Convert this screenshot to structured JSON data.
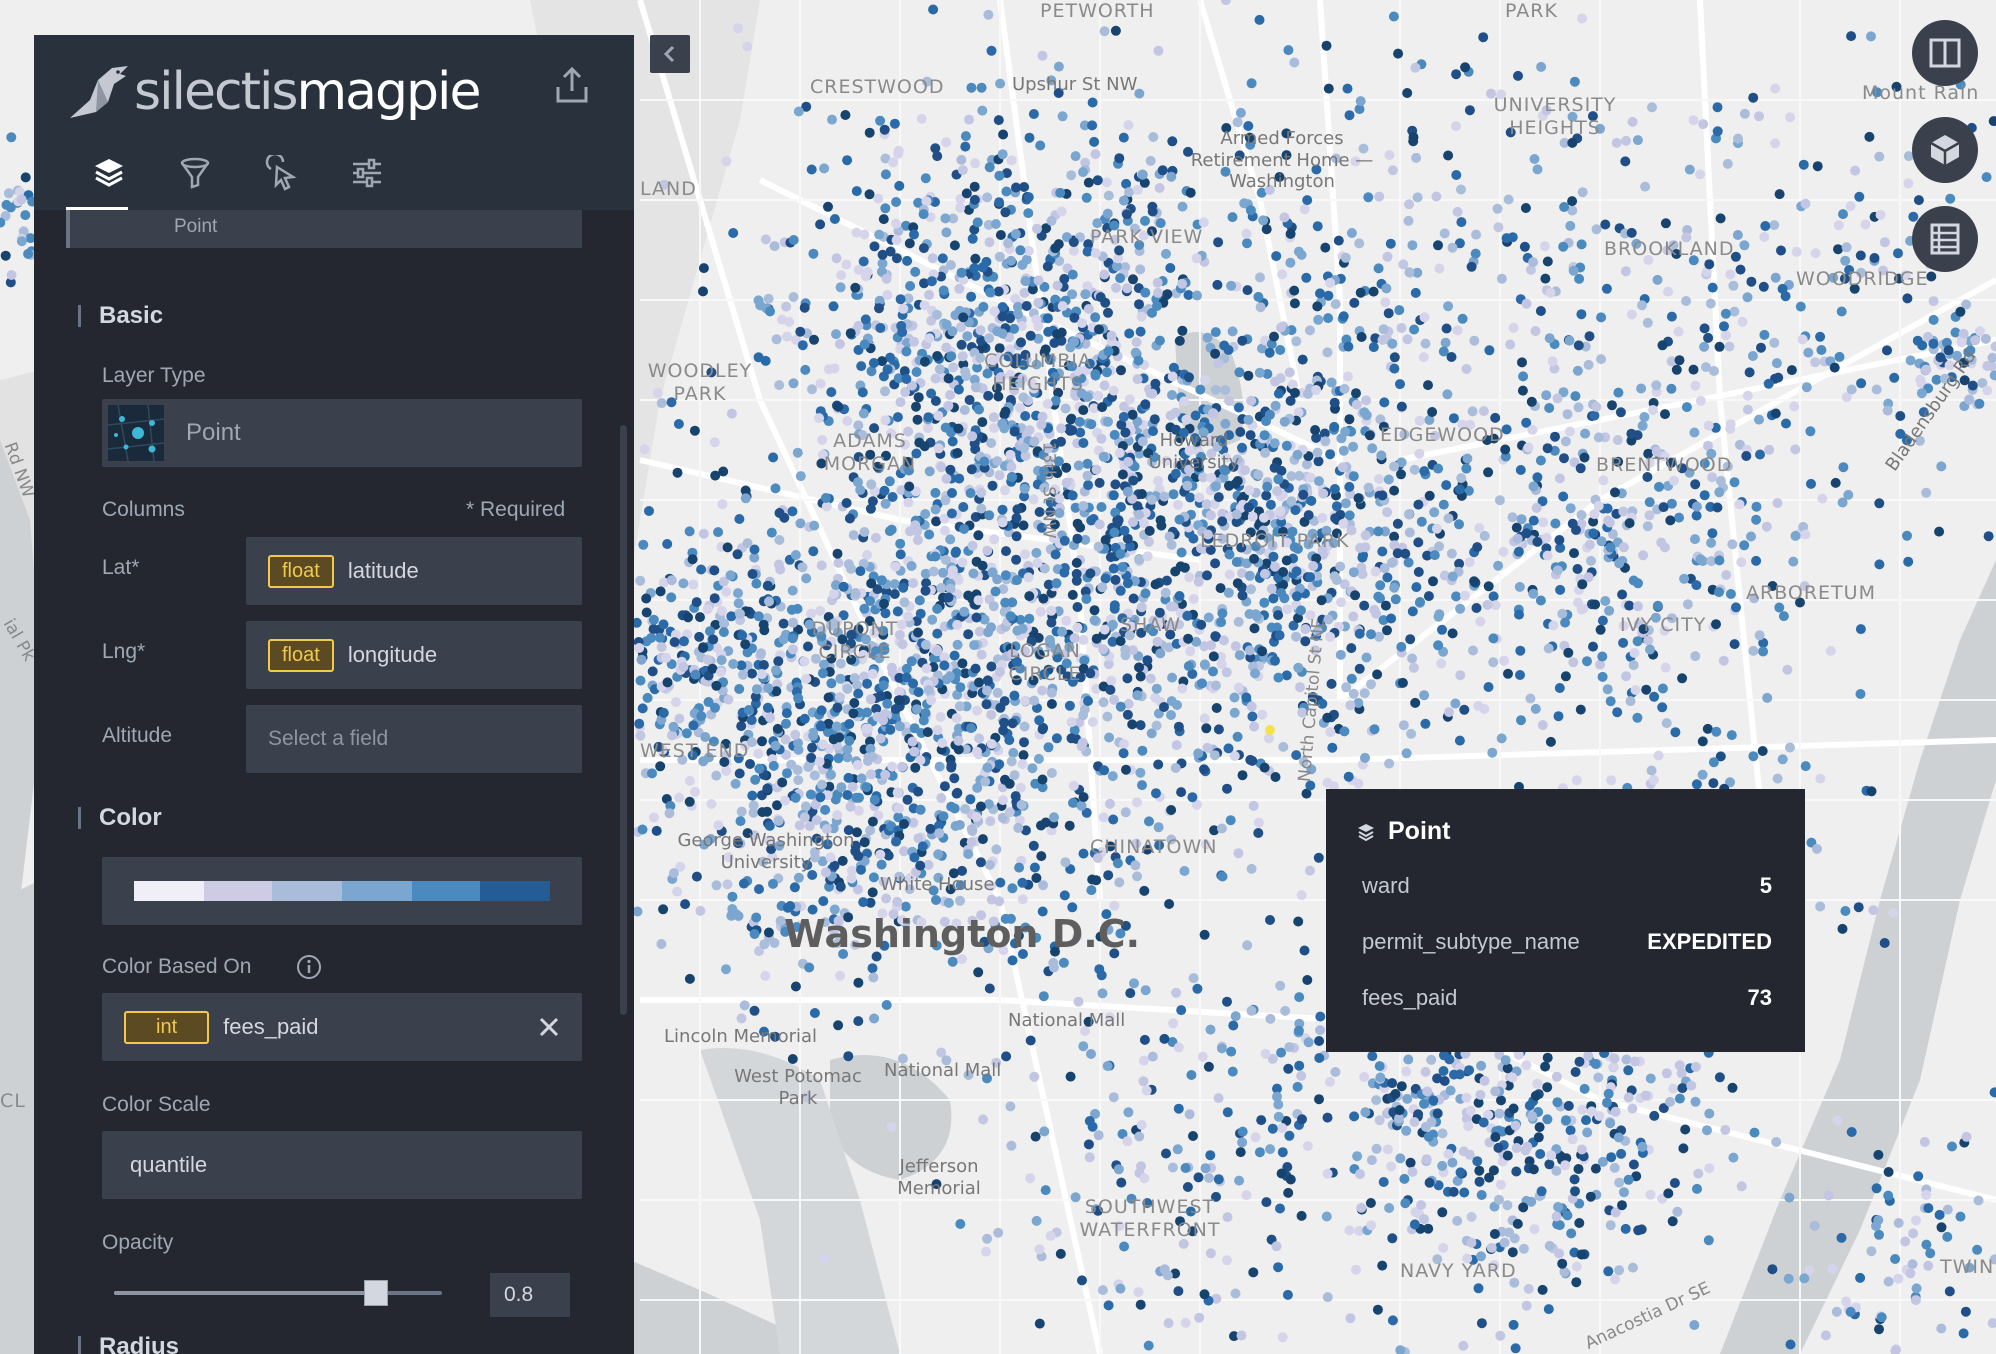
{
  "app": {
    "logo_brand": "silectis",
    "logo_product": "magpie"
  },
  "tabs": [
    {
      "name": "layers-tab",
      "icon": "layers-icon",
      "active": true
    },
    {
      "name": "filters-tab",
      "icon": "funnel-icon",
      "active": false
    },
    {
      "name": "interactions-tab",
      "icon": "cursor-click-icon",
      "active": false
    },
    {
      "name": "map-settings-tab",
      "icon": "sliders-icon",
      "active": false
    }
  ],
  "layer": {
    "title": "Point",
    "sections": {
      "basic": "Basic",
      "color": "Color",
      "radius": "Radius"
    },
    "layer_type_label": "Layer Type",
    "layer_type_value": "Point",
    "columns_label": "Columns",
    "required_label": "* Required",
    "lat_label": "Lat*",
    "lat_type": "float",
    "lat_field": "latitude",
    "lng_label": "Lng*",
    "lng_type": "float",
    "lng_field": "longitude",
    "altitude_label": "Altitude",
    "altitude_placeholder": "Select a field",
    "color_based_on_label": "Color Based On",
    "color_field_type": "int",
    "color_field": "fees_paid",
    "color_scale_label": "Color Scale",
    "color_scale_value": "quantile",
    "opacity_label": "Opacity",
    "opacity_value": "0.8",
    "opacity_fraction": 0.8,
    "color_ramp": [
      "#f0eff8",
      "#cdcce4",
      "#a9bddb",
      "#7ba6d0",
      "#4a8abf",
      "#245c96"
    ]
  },
  "tooltip": {
    "title": "Point",
    "rows": [
      {
        "key": "ward",
        "value": "5"
      },
      {
        "key": "permit_subtype_name",
        "value": "EXPEDITED"
      },
      {
        "key": "fees_paid",
        "value": "73"
      }
    ]
  },
  "map": {
    "labels": {
      "petworth": "PETWORTH",
      "park": "PARK",
      "crestwood": "CRESTWOOD",
      "upshur": "Upshur St NW",
      "university_heights": "UNIVERSITY HEIGHTS",
      "mount_rainier": "Mount Rain",
      "armed_forces": "Armed Forces Retirement Home — Washington",
      "land": "LAND",
      "parkview": "PARK VIEW",
      "brookland": "BROOKLAND",
      "woodridge": "WOODRIDGE",
      "woodley_park": "WOODLEY PARK",
      "columbia_heights": "COLUMBIA HEIGHTS",
      "howard": "Howard University",
      "edgewood": "EDGEWOOD",
      "brentwood": "BRENTWOOD",
      "bladensburg": "Bladensburg Rd",
      "adams_morgan": "ADAMS MORGAN",
      "thirteenth": "13th St NW",
      "ledroit": "LEDROIT PARK",
      "arboretum": "ARBORETUM",
      "ivy_city": "IVY CITY",
      "dupont": "DUPONT CIRCLE",
      "logan": "LOGAN CIRCLE",
      "shaw": "SHAW",
      "north_capitol": "North Capitol St NE",
      "west_end": "WEST END",
      "chinatown": "CHINATOWN",
      "gwu": "George Washington University",
      "white_house": "White House",
      "city": "Washington D.C.",
      "national_mall_1": "National Mall",
      "national_mall_2": "National Mall",
      "lincoln": "Lincoln Memorial",
      "west_potomac": "West Potomac Park",
      "jefferson": "Jefferson Memorial",
      "southwest": "SOUTHWEST WATERFRONT",
      "navy_yard": "NAVY YARD",
      "anacostia": "Anacostia Dr SE",
      "twin": "TWIN",
      "nw_left": "Rd NW",
      "cl": "CL",
      "ial_pk": "ial Pk"
    },
    "point_colors": [
      "#d5d4ea",
      "#c2c6e2",
      "#a9bddb",
      "#7ba6d0",
      "#4a8abf",
      "#2a6aa8",
      "#1f4f86",
      "#17436f"
    ],
    "highlight_color": "#f2e34c"
  }
}
